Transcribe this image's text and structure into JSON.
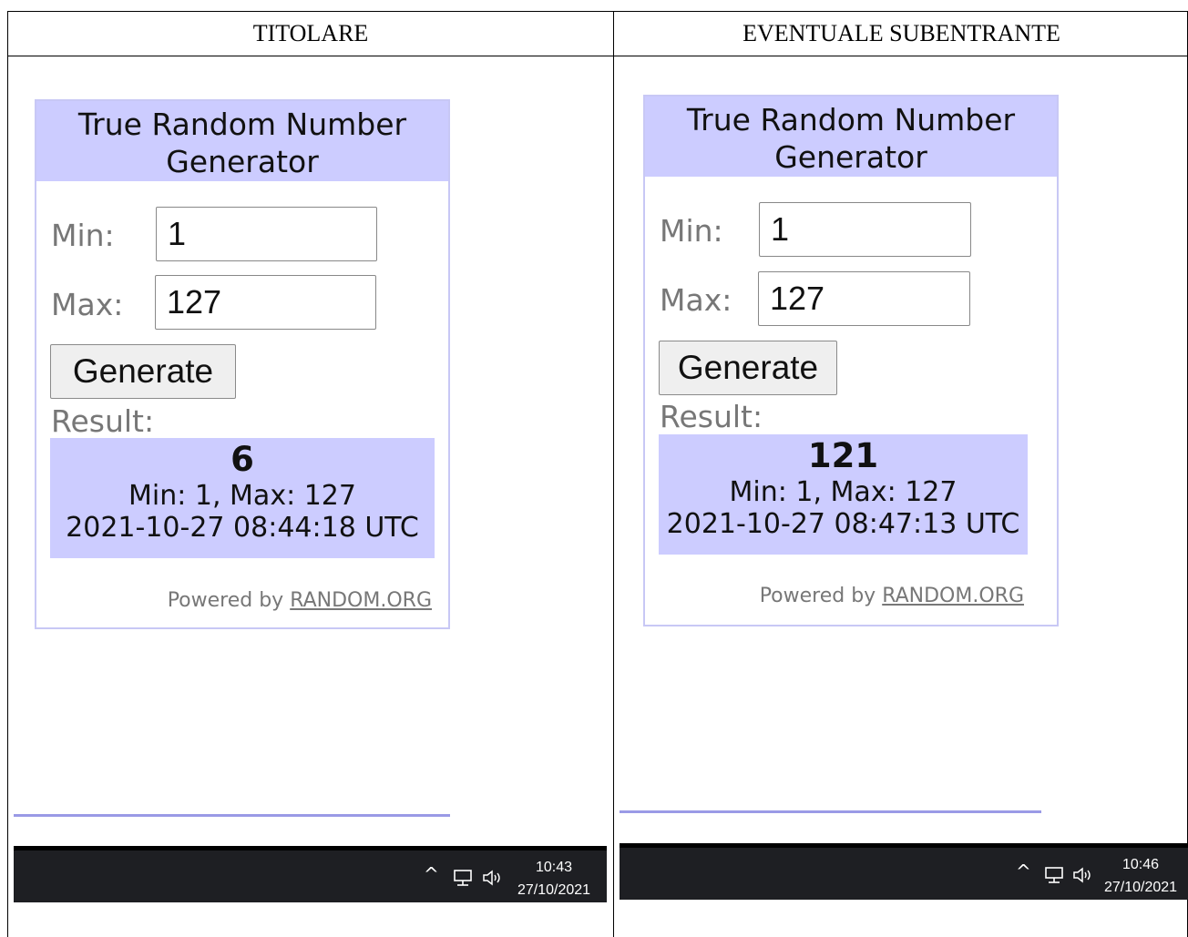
{
  "table": {
    "headers": [
      "TITOLARE",
      "EVENTUALE SUBENTRANTE"
    ]
  },
  "panels": [
    {
      "widget": {
        "title": "True Random Number Generator",
        "min_label": "Min:",
        "max_label": "Max:",
        "min_value": "1",
        "max_value": "127",
        "generate_label": "Generate",
        "result_label": "Result:",
        "result_number": "6",
        "result_range": "Min: 1, Max: 127",
        "result_timestamp": "2021-10-27 08:44:18 UTC",
        "powered_by": "Powered by",
        "powered_link": "RANDOM.ORG"
      },
      "taskbar": {
        "up_arrow": "^",
        "network_icon": "network-icon",
        "volume_icon": "volume-icon",
        "time": "10:43",
        "date": "27/10/2021"
      }
    },
    {
      "widget": {
        "title": "True Random Number Generator",
        "min_label": "Min:",
        "max_label": "Max:",
        "min_value": "1",
        "max_value": "127",
        "generate_label": "Generate",
        "result_label": "Result:",
        "result_number": "121",
        "result_range": "Min: 1, Max: 127",
        "result_timestamp": "2021-10-27 08:47:13 UTC",
        "powered_by": "Powered by",
        "powered_link": "RANDOM.ORG"
      },
      "taskbar": {
        "up_arrow": "^",
        "network_icon": "network-icon",
        "volume_icon": "volume-icon",
        "time": "10:46",
        "date": "27/10/2021"
      }
    }
  ],
  "colors": {
    "widget_header_bg": "#ccccff",
    "widget_border": "#c8c8f5",
    "taskbar_bg": "#1e1f23"
  }
}
